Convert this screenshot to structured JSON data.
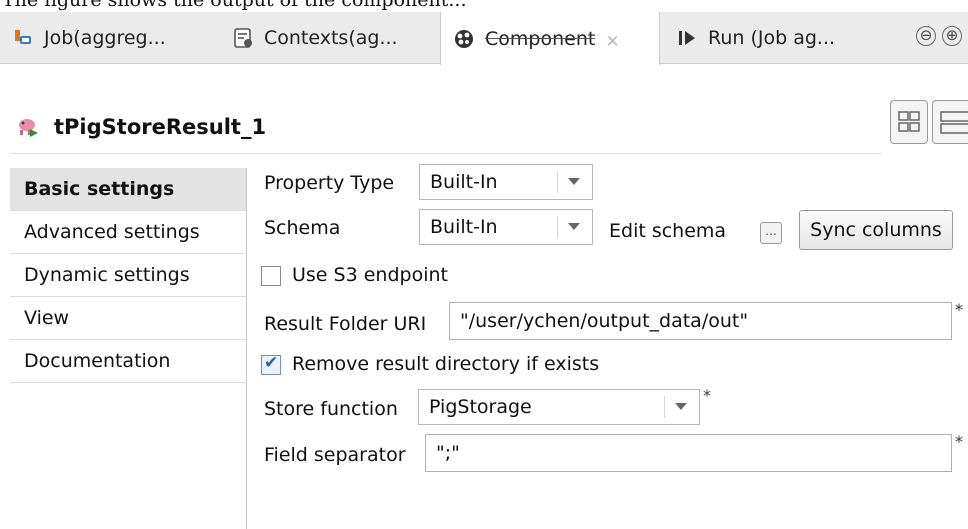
{
  "caption": "The figure shows the output of the component...",
  "tabs": [
    {
      "label": "Job(aggreg...",
      "icon": "job-icon"
    },
    {
      "label": "Contexts(ag...",
      "icon": "contexts-icon"
    },
    {
      "label": "Component",
      "icon": "component-icon",
      "active": true
    },
    {
      "label": "Run (Job ag...",
      "icon": "run-icon"
    }
  ],
  "window_controls": {
    "minimize": "⊖",
    "maximize": "⊕"
  },
  "component": {
    "title": "tPigStoreResult_1",
    "icon": "pig-store-icon"
  },
  "nav": {
    "items": [
      {
        "label": "Basic settings",
        "active": true
      },
      {
        "label": "Advanced settings"
      },
      {
        "label": "Dynamic settings"
      },
      {
        "label": "View"
      },
      {
        "label": "Documentation"
      }
    ]
  },
  "form": {
    "property_type_label": "Property Type",
    "property_type_value": "Built-In",
    "schema_label": "Schema",
    "schema_value": "Built-In",
    "edit_schema_label": "Edit schema",
    "edit_schema_button": "...",
    "sync_columns_label": "Sync columns",
    "use_s3_label": "Use S3 endpoint",
    "use_s3_checked": false,
    "result_folder_label": "Result Folder URI",
    "result_folder_value": "\"/user/ychen/output_data/out\"",
    "remove_dir_label": "Remove result directory if exists",
    "remove_dir_checked": true,
    "store_function_label": "Store function",
    "store_function_value": "PigStorage",
    "field_separator_label": "Field separator",
    "field_separator_value": "\";\"",
    "required_marker": "*"
  },
  "colors": {
    "accent": "#2b5fb0",
    "pig": "#3a8c2f"
  }
}
